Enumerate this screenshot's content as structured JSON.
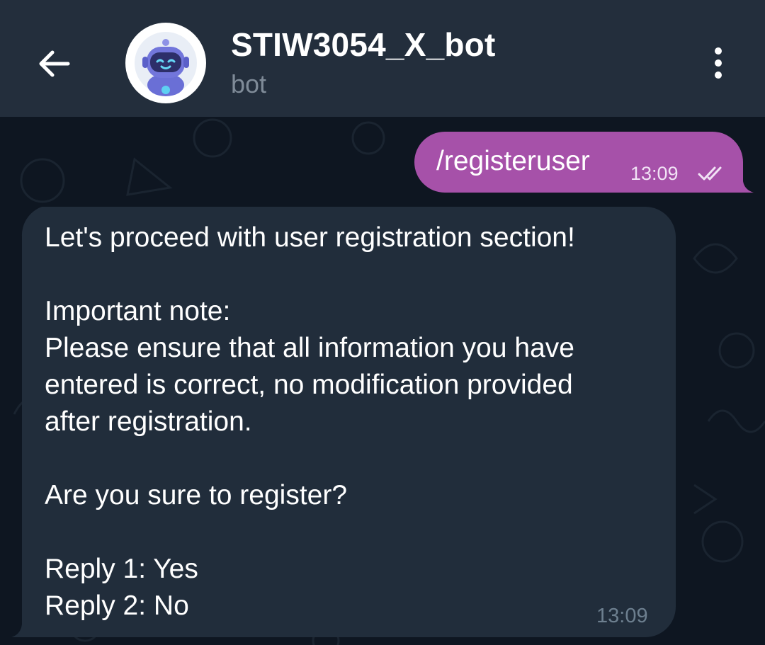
{
  "header": {
    "title": "STIW3054_X_bot",
    "subtitle": "bot",
    "back_icon": "arrow-left-icon",
    "menu_icon": "more-vertical-icon",
    "avatar_icon": "robot-icon"
  },
  "messages": {
    "outgoing": {
      "text": "/registeruser",
      "time": "13:09",
      "status_icon": "double-check-icon",
      "color": "#a651a9"
    },
    "incoming": {
      "lines": [
        "Let's proceed with user registration section!",
        "Important note:",
        "Please ensure that all information you have",
        "entered is correct, no modification provided",
        "after registration.",
        "Are you sure to register?",
        "Reply 1: Yes",
        "Reply 2: No"
      ],
      "time": "13:09",
      "color": "#212d3b"
    }
  },
  "colors": {
    "header": "#232e3c",
    "chat_background": "#0e1621",
    "outgoing_bubble": "#a651a9",
    "incoming_bubble": "#212d3b"
  }
}
